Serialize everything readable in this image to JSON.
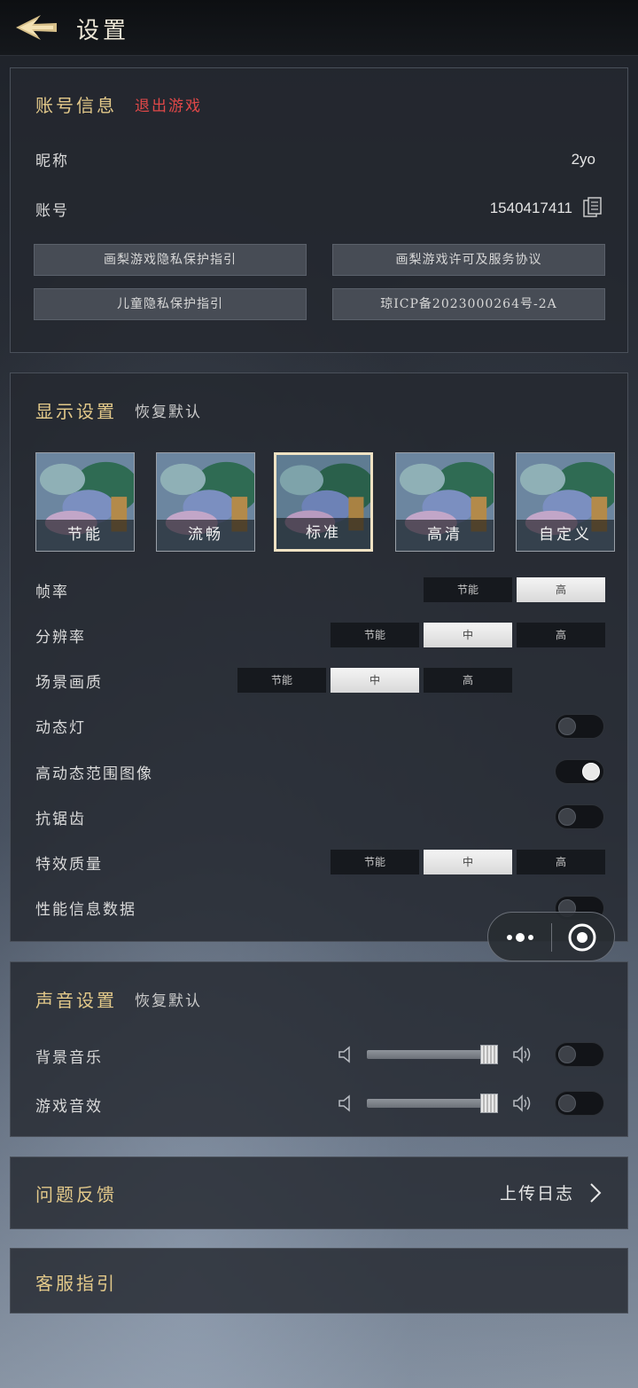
{
  "header": {
    "title": "设置"
  },
  "account": {
    "heading": "账号信息",
    "logout": "退出游戏",
    "nickname_label": "昵称",
    "nickname_value": "2yo",
    "account_label": "账号",
    "account_value": "1540417411",
    "links": [
      "画梨游戏隐私保护指引",
      "画梨游戏许可及服务协议",
      "儿童隐私保护指引",
      "琼ICP备2023000264号-2A"
    ]
  },
  "display": {
    "heading": "显示设置",
    "reset": "恢复默认",
    "presets": [
      "节能",
      "流畅",
      "标准",
      "高清",
      "自定义"
    ],
    "selected_preset": "标准",
    "rows": {
      "framerate": {
        "label": "帧率",
        "options": [
          "节能",
          "高"
        ],
        "selected": "高"
      },
      "resolution": {
        "label": "分辨率",
        "options": [
          "节能",
          "中",
          "高"
        ],
        "selected": "中"
      },
      "scene_quality": {
        "label": "场景画质",
        "options": [
          "节能",
          "中",
          "高"
        ],
        "selected": "中"
      },
      "dynamic_light": {
        "label": "动态灯",
        "on": false
      },
      "hdr": {
        "label": "高动态范围图像",
        "on": true
      },
      "antialias": {
        "label": "抗锯齿",
        "on": false
      },
      "effects_quality": {
        "label": "特效质量",
        "options": [
          "节能",
          "中",
          "高"
        ],
        "selected": "中"
      },
      "perf_data": {
        "label": "性能信息数据",
        "on": false
      }
    }
  },
  "sound": {
    "heading": "声音设置",
    "reset": "恢复默认",
    "bgm": {
      "label": "背景音乐",
      "level": 1.0,
      "on": false
    },
    "sfx": {
      "label": "游戏音效",
      "level": 1.0,
      "on": false
    }
  },
  "feedback": {
    "heading": "问题反馈",
    "action": "上传日志"
  },
  "support": {
    "heading": "客服指引"
  },
  "colors": {
    "gold": "#e3c98a",
    "red": "#e04848",
    "panel": "#24282f"
  }
}
